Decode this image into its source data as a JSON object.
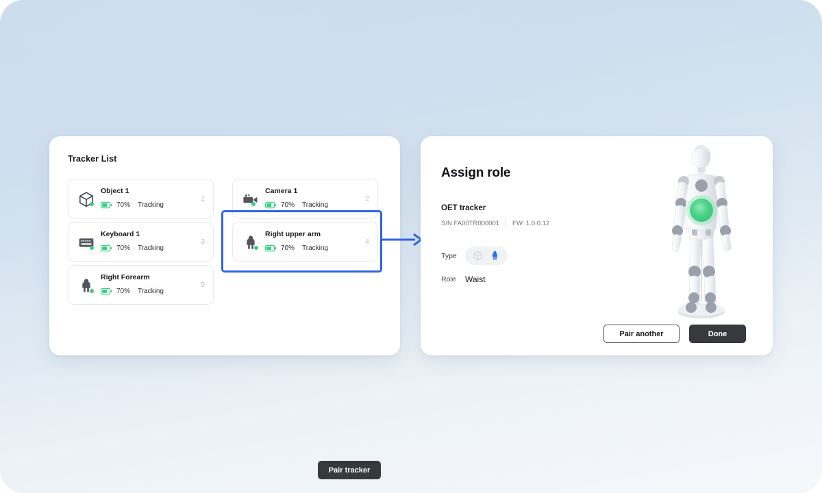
{
  "left_panel": {
    "title": "Tracker List",
    "trackers_column_1": [
      {
        "name": "Object 1",
        "icon": "cube-icon",
        "battery": "70%",
        "status": "Tracking",
        "index": "1"
      },
      {
        "name": "Keyboard 1",
        "icon": "keyboard-icon",
        "battery": "70%",
        "status": "Tracking",
        "index": "3"
      },
      {
        "name": "Right Forearm",
        "icon": "person-icon",
        "battery": "70%",
        "status": "Tracking",
        "index": "5"
      }
    ],
    "trackers_column_2": [
      {
        "name": "Camera 1",
        "icon": "camera-icon",
        "battery": "70%",
        "status": "Tracking",
        "index": "2"
      },
      {
        "name": "Right upper arm",
        "icon": "person-icon",
        "battery": "70%",
        "status": "Tracking",
        "index": "4"
      }
    ],
    "pair_tracker_label": "Pair tracker"
  },
  "right_panel": {
    "title": "Assign role",
    "device_name": "OET tracker",
    "serial_number": "S/N FA00TR000001",
    "firmware": "FW: 1.0.0.12",
    "type_label": "Type",
    "type_options": [
      {
        "icon": "cube-icon",
        "selected": false
      },
      {
        "icon": "person-icon",
        "selected": true
      }
    ],
    "role_label": "Role",
    "role_value": "Waist",
    "mannequin_highlight": "waist",
    "pair_another_label": "Pair another",
    "done_label": "Done"
  },
  "colors": {
    "accent_blue": "#2e63e8",
    "battery_green": "#34d07f",
    "dark_button": "#37393d",
    "card_border": "#e6e8ec",
    "muted_text": "#6c7079",
    "index_text": "#b9bfc8",
    "highlight_green": "#4fd38a"
  }
}
